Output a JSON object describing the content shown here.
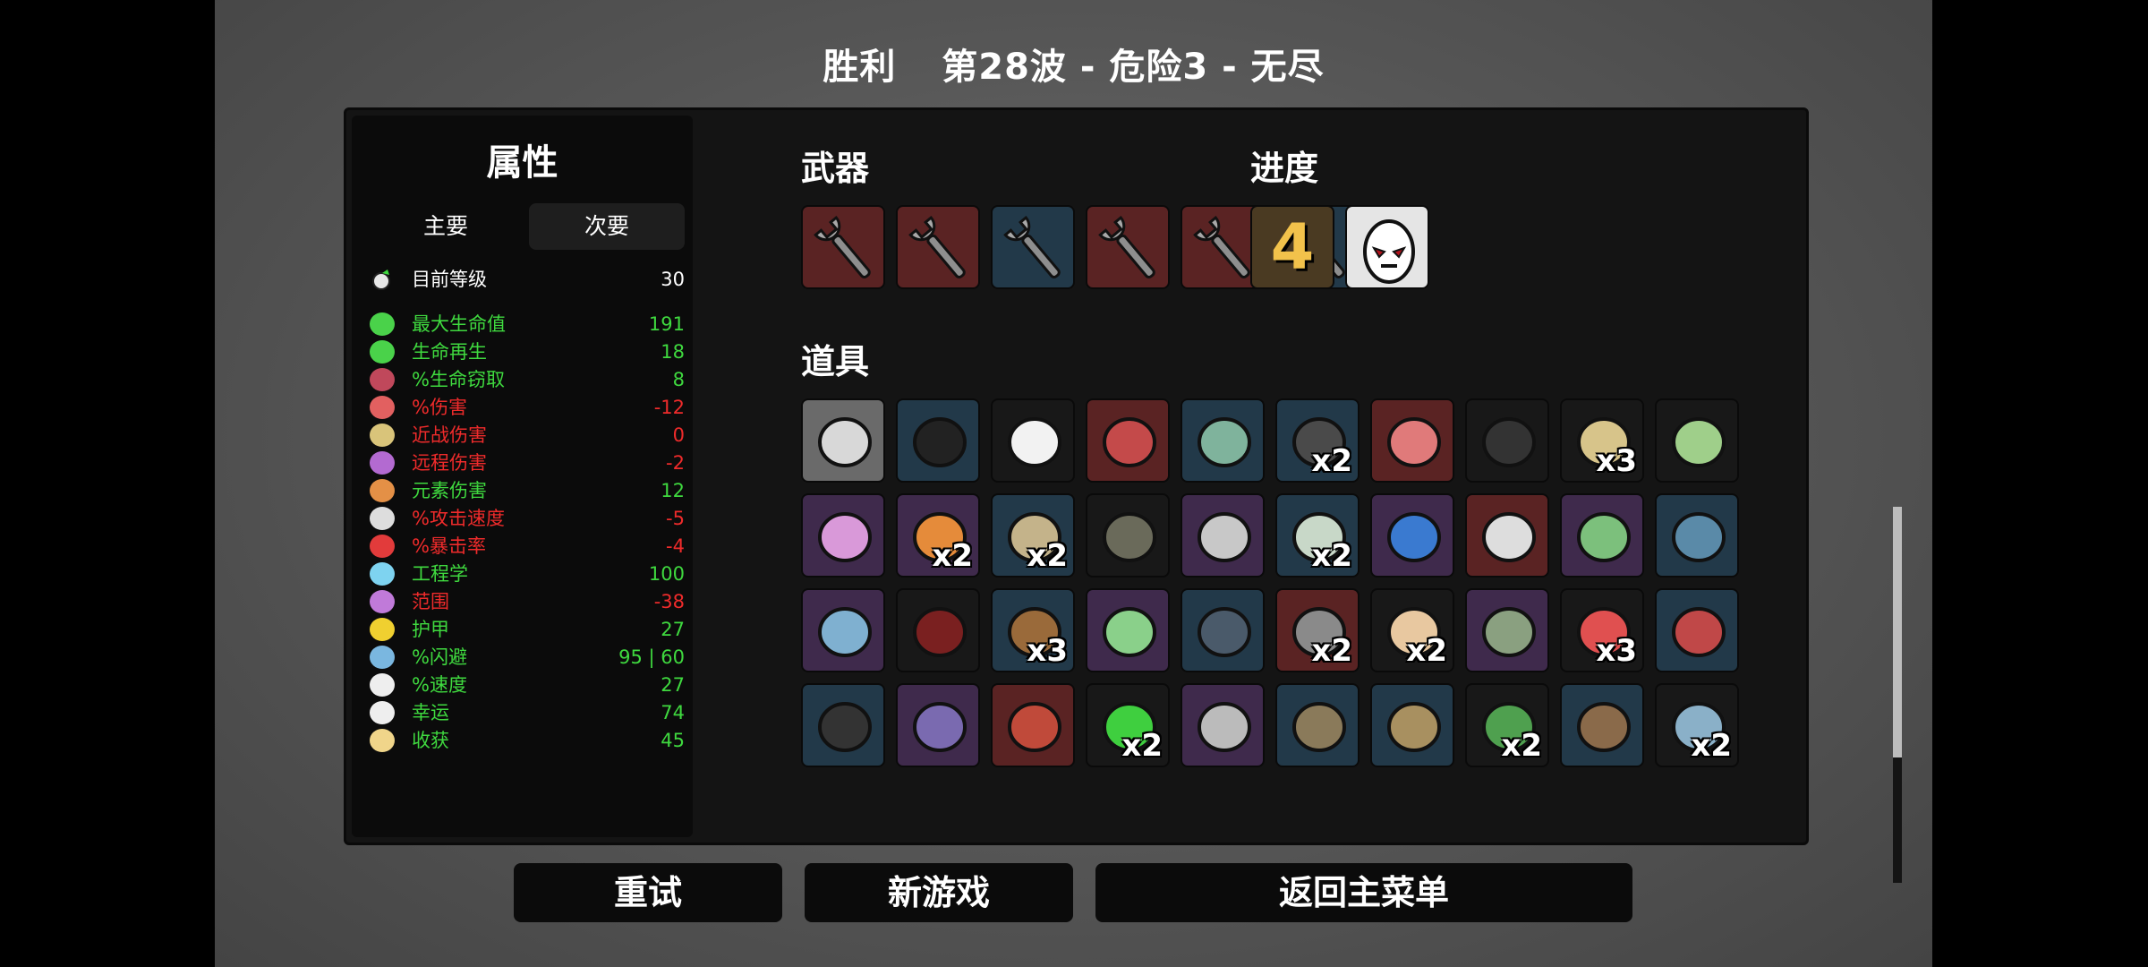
{
  "header": {
    "result": "胜利",
    "wave_info": "第28波 - 危险3 - 无尽"
  },
  "stats_panel": {
    "title": "属性",
    "tabs": [
      "主要",
      "次要"
    ],
    "level": {
      "label": "目前等级",
      "value": "30"
    },
    "rows": [
      {
        "label": "最大生命值",
        "value": "191",
        "color": "#3fd93f",
        "icon": "heart-icon"
      },
      {
        "label": "生命再生",
        "value": "18",
        "color": "#3fd93f",
        "icon": "regen-icon"
      },
      {
        "label": "%生命窃取",
        "value": "8",
        "color": "#3fd93f",
        "icon": "fangs-icon"
      },
      {
        "label": "%伤害",
        "value": "-12",
        "color": "#ef2b2b",
        "icon": "muscle-icon"
      },
      {
        "label": "近战伤害",
        "value": "0",
        "color": "#ef2b2b",
        "icon": "sword-icon"
      },
      {
        "label": "远程伤害",
        "value": "-2",
        "color": "#ef2b2b",
        "icon": "bow-icon"
      },
      {
        "label": "元素伤害",
        "value": "12",
        "color": "#3fd93f",
        "icon": "flame-icon"
      },
      {
        "label": "%攻击速度",
        "value": "-5",
        "color": "#ef2b2b",
        "icon": "hourglass-icon"
      },
      {
        "label": "%暴击率",
        "value": "-4",
        "color": "#ef2b2b",
        "icon": "crit-icon"
      },
      {
        "label": "工程学",
        "value": "100",
        "color": "#3fd93f",
        "icon": "wrench-cross-icon"
      },
      {
        "label": "范围",
        "value": "-38",
        "color": "#ef2b2b",
        "icon": "range-icon"
      },
      {
        "label": "护甲",
        "value": "27",
        "color": "#3fd93f",
        "icon": "shield-icon"
      },
      {
        "label": "%闪避",
        "value": "95 | 60",
        "color": "#3fd93f",
        "icon": "dodge-icon"
      },
      {
        "label": "%速度",
        "value": "27",
        "color": "#3fd93f",
        "icon": "boot-icon"
      },
      {
        "label": "幸运",
        "value": "74",
        "color": "#3fd93f",
        "icon": "dice-icon"
      },
      {
        "label": "收获",
        "value": "45",
        "color": "#3fd93f",
        "icon": "wheat-icon"
      }
    ]
  },
  "weapons": {
    "title": "武器",
    "items": [
      {
        "icon": "wrench-icon",
        "tier": "red"
      },
      {
        "icon": "wrench-icon",
        "tier": "red"
      },
      {
        "icon": "wrench-icon",
        "tier": "blue"
      },
      {
        "icon": "wrench-icon",
        "tier": "red"
      },
      {
        "icon": "wrench-icon",
        "tier": "red"
      },
      {
        "icon": "wrench-icon",
        "tier": "blue"
      }
    ]
  },
  "progress": {
    "title": "进度",
    "danger_level": "4",
    "character_icon": "egg-face-icon"
  },
  "items": {
    "title": "道具",
    "grid": [
      {
        "icon": "helmet-icon",
        "tier": "gray",
        "count": ""
      },
      {
        "icon": "black-spots-icon",
        "tier": "blue",
        "count": ""
      },
      {
        "icon": "ghost-icon",
        "tier": "dark",
        "count": ""
      },
      {
        "icon": "cape-icon",
        "tier": "red",
        "count": ""
      },
      {
        "icon": "turret-machine-icon",
        "tier": "blue",
        "count": ""
      },
      {
        "icon": "bomb-bag-icon",
        "tier": "blue",
        "count": "x2"
      },
      {
        "icon": "octopus-icon",
        "tier": "red",
        "count": ""
      },
      {
        "icon": "coal-icon",
        "tier": "dark",
        "count": ""
      },
      {
        "icon": "speaker-icon",
        "tier": "dark",
        "count": "x3"
      },
      {
        "icon": "money-note-icon",
        "tier": "dark",
        "count": ""
      },
      {
        "icon": "brain-icon",
        "tier": "purple",
        "count": ""
      },
      {
        "icon": "orbit-drone-icon",
        "tier": "purple",
        "count": "x2"
      },
      {
        "icon": "mirror-icon",
        "tier": "blue",
        "count": "x2"
      },
      {
        "icon": "scythe-icon",
        "tier": "dark",
        "count": ""
      },
      {
        "icon": "tardigrade-icon",
        "tier": "purple",
        "count": ""
      },
      {
        "icon": "medic-bag-icon",
        "tier": "blue",
        "count": "x2"
      },
      {
        "icon": "peacock-icon",
        "tier": "purple",
        "count": ""
      },
      {
        "icon": "energy-orb-icon",
        "tier": "red",
        "count": ""
      },
      {
        "icon": "tractor-icon",
        "tier": "purple",
        "count": ""
      },
      {
        "icon": "robot-arm-icon",
        "tier": "blue",
        "count": ""
      },
      {
        "icon": "toolbox-icon",
        "tier": "purple",
        "count": ""
      },
      {
        "icon": "plaid-shirt-icon",
        "tier": "dark",
        "count": ""
      },
      {
        "icon": "larva-icon",
        "tier": "blue",
        "count": "x3"
      },
      {
        "icon": "chameleon-icon",
        "tier": "purple",
        "count": ""
      },
      {
        "icon": "diving-suit-icon",
        "tier": "blue",
        "count": ""
      },
      {
        "icon": "spider-robot-icon",
        "tier": "red",
        "count": "x2"
      },
      {
        "icon": "baby-head-icon",
        "tier": "dark",
        "count": "x2"
      },
      {
        "icon": "zombie-head-icon",
        "tier": "purple",
        "count": ""
      },
      {
        "icon": "propeller-hat-icon",
        "tier": "dark",
        "count": "x3"
      },
      {
        "icon": "claw-icon",
        "tier": "blue",
        "count": ""
      },
      {
        "icon": "scarf-icon",
        "tier": "blue",
        "count": ""
      },
      {
        "icon": "alien-baby-icon",
        "tier": "purple",
        "count": ""
      },
      {
        "icon": "stomach-icon",
        "tier": "red",
        "count": ""
      },
      {
        "icon": "green-slime-icon",
        "tier": "dark",
        "count": "x2"
      },
      {
        "icon": "knight-helmet-icon",
        "tier": "purple",
        "count": ""
      },
      {
        "icon": "wheelbarrow-icon",
        "tier": "blue",
        "count": ""
      },
      {
        "icon": "garden-bed-icon",
        "tier": "blue",
        "count": ""
      },
      {
        "icon": "sprout-icon",
        "tier": "dark",
        "count": "x2"
      },
      {
        "icon": "vest-icon",
        "tier": "blue",
        "count": ""
      },
      {
        "icon": "ice-bucket-icon",
        "tier": "dark",
        "count": "x2"
      }
    ]
  },
  "buttons": {
    "retry": "重试",
    "new_game": "新游戏",
    "main_menu": "返回主菜单"
  }
}
